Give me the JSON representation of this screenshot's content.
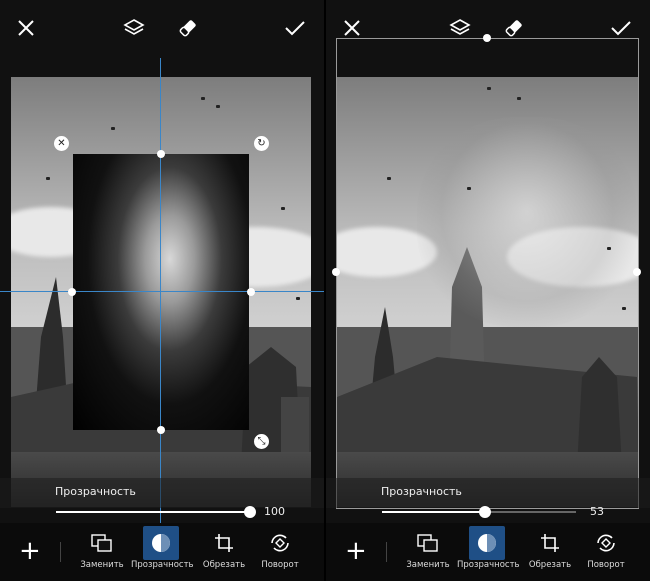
{
  "panels": [
    {
      "top_icons": [
        "close-icon",
        "layers-icon",
        "eraser-icon",
        "checkmark-icon"
      ],
      "opacity_label": "Прозрачность",
      "opacity_value": "100",
      "opacity_fraction": 1.0,
      "tools": [
        {
          "label": "Заменить",
          "icon": "replace-icon"
        },
        {
          "label": "Прозрачность",
          "icon": "opacity-icon",
          "active": true
        },
        {
          "label": "Обрезать",
          "icon": "crop-icon"
        },
        {
          "label": "Поворот",
          "icon": "rotate-icon"
        }
      ]
    },
    {
      "top_icons": [
        "close-icon",
        "layers-icon",
        "eraser-icon",
        "checkmark-icon"
      ],
      "opacity_label": "Прозрачность",
      "opacity_value": "53",
      "opacity_fraction": 0.53,
      "tools": [
        {
          "label": "Заменить",
          "icon": "replace-icon"
        },
        {
          "label": "Прозрачность",
          "icon": "opacity-icon",
          "active": true
        },
        {
          "label": "Обрезать",
          "icon": "crop-icon"
        },
        {
          "label": "Поворот",
          "icon": "rotate-icon"
        }
      ]
    }
  ],
  "colors": {
    "accent": "#1f4f86",
    "guide": "#3a86c8"
  }
}
